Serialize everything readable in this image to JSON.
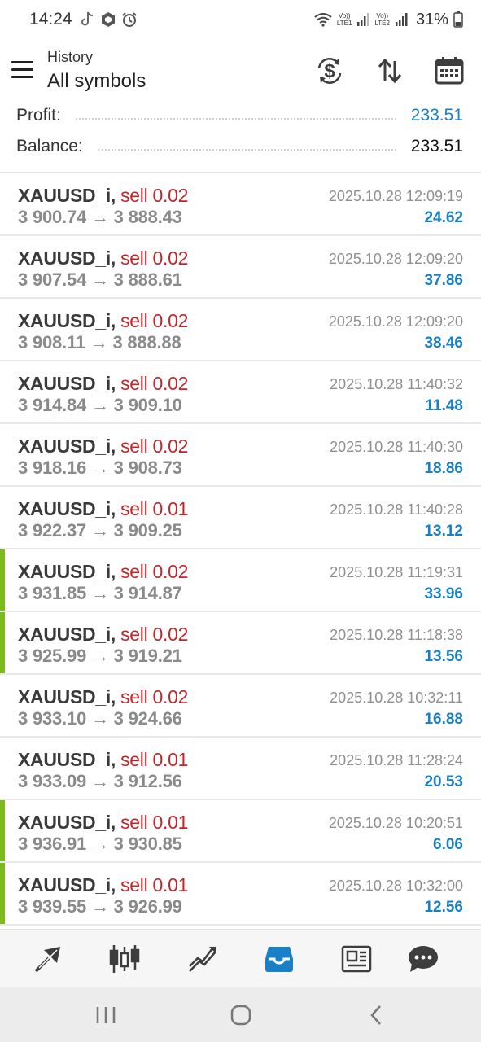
{
  "status_bar": {
    "time": "14:24",
    "lte1": "LTE1",
    "lte2": "LTE2",
    "volte": "Vo))",
    "battery": "31%"
  },
  "header": {
    "subtitle": "History",
    "title": "All symbols",
    "icons": [
      "menu-icon",
      "currency-exchange-icon",
      "sort-icon",
      "calendar-icon"
    ]
  },
  "summary": {
    "profit_label": "Profit:",
    "profit_value": "233.51",
    "balance_label": "Balance:",
    "balance_value": "233.51"
  },
  "deals": [
    {
      "symbol": "XAUUSD_i,",
      "side": "sell 0.02",
      "prices": "3 900.74 → 3 888.43",
      "datetime": "2025.10.28 12:09:19",
      "profit": "24.62",
      "marked": false
    },
    {
      "symbol": "XAUUSD_i,",
      "side": "sell 0.02",
      "prices": "3 907.54 → 3 888.61",
      "datetime": "2025.10.28 12:09:20",
      "profit": "37.86",
      "marked": false
    },
    {
      "symbol": "XAUUSD_i,",
      "side": "sell 0.02",
      "prices": "3 908.11 → 3 888.88",
      "datetime": "2025.10.28 12:09:20",
      "profit": "38.46",
      "marked": false
    },
    {
      "symbol": "XAUUSD_i,",
      "side": "sell 0.02",
      "prices": "3 914.84 → 3 909.10",
      "datetime": "2025.10.28 11:40:32",
      "profit": "11.48",
      "marked": false
    },
    {
      "symbol": "XAUUSD_i,",
      "side": "sell 0.02",
      "prices": "3 918.16 → 3 908.73",
      "datetime": "2025.10.28 11:40:30",
      "profit": "18.86",
      "marked": false
    },
    {
      "symbol": "XAUUSD_i,",
      "side": "sell 0.01",
      "prices": "3 922.37 → 3 909.25",
      "datetime": "2025.10.28 11:40:28",
      "profit": "13.12",
      "marked": false
    },
    {
      "symbol": "XAUUSD_i,",
      "side": "sell 0.02",
      "prices": "3 931.85 → 3 914.87",
      "datetime": "2025.10.28 11:19:31",
      "profit": "33.96",
      "marked": true
    },
    {
      "symbol": "XAUUSD_i,",
      "side": "sell 0.02",
      "prices": "3 925.99 → 3 919.21",
      "datetime": "2025.10.28 11:18:38",
      "profit": "13.56",
      "marked": true
    },
    {
      "symbol": "XAUUSD_i,",
      "side": "sell 0.02",
      "prices": "3 933.10 → 3 924.66",
      "datetime": "2025.10.28 10:32:11",
      "profit": "16.88",
      "marked": false
    },
    {
      "symbol": "XAUUSD_i,",
      "side": "sell 0.01",
      "prices": "3 933.09 → 3 912.56",
      "datetime": "2025.10.28 11:28:24",
      "profit": "20.53",
      "marked": false
    },
    {
      "symbol": "XAUUSD_i,",
      "side": "sell 0.01",
      "prices": "3 936.91 → 3 930.85",
      "datetime": "2025.10.28 10:20:51",
      "profit": "6.06",
      "marked": true
    },
    {
      "symbol": "XAUUSD_i,",
      "side": "sell 0.01",
      "prices": "3 939.55 → 3 926.99",
      "datetime": "2025.10.28 10:32:00",
      "profit": "12.56",
      "marked": true
    }
  ],
  "tabs": [
    {
      "icon": "trade-icon",
      "active": false
    },
    {
      "icon": "candlestick-chart-icon",
      "active": false
    },
    {
      "icon": "trend-chart-icon",
      "active": false
    },
    {
      "icon": "history-inbox-icon",
      "active": true
    },
    {
      "icon": "news-icon",
      "active": false
    },
    {
      "icon": "chat-icon",
      "active": false
    }
  ],
  "colors": {
    "accent": "#1a7fc4",
    "sell": "#c2262b",
    "marker": "#7cba1e",
    "icon": "#3d3d3d"
  }
}
